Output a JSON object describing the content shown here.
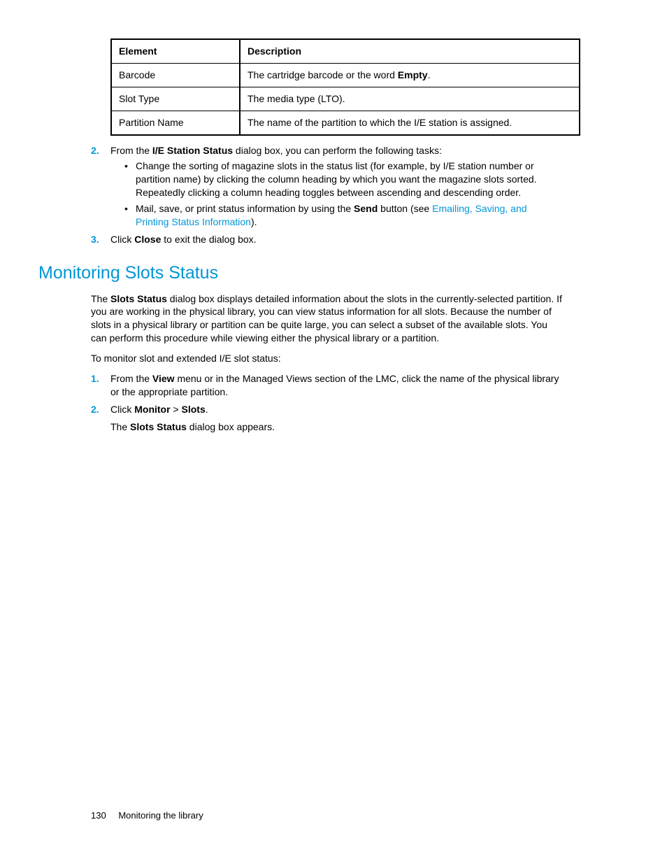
{
  "table": {
    "headers": {
      "element": "Element",
      "description": "Description"
    },
    "rows": [
      {
        "element": "Barcode",
        "desc_pre": "The cartridge barcode or the word ",
        "desc_bold": "Empty",
        "desc_post": "."
      },
      {
        "element": "Slot Type",
        "desc_pre": "The media type (LTO).",
        "desc_bold": "",
        "desc_post": ""
      },
      {
        "element": "Partition Name",
        "desc_pre": "The name of the partition to which the I/E station is assigned.",
        "desc_bold": "",
        "desc_post": ""
      }
    ]
  },
  "step2": {
    "num": "2.",
    "pre": "From the ",
    "bold": "I/E Station Status",
    "post": " dialog box, you can perform the following tasks:",
    "bullet1": "Change the sorting of magazine slots in the status list (for example, by I/E station number or partition name) by clicking the column heading by which you want the magazine slots sorted. Repeatedly clicking a column heading toggles between ascending and descending order.",
    "bullet2_pre": "Mail, save, or print status information by using the ",
    "bullet2_bold": "Send",
    "bullet2_mid": " button (see ",
    "bullet2_link": "Emailing, Saving, and Printing Status Information",
    "bullet2_post": ")."
  },
  "step3": {
    "num": "3.",
    "pre": "Click ",
    "bold": "Close",
    "post": " to exit the dialog box."
  },
  "section": {
    "title": "Monitoring Slots Status",
    "para1_pre": "The ",
    "para1_bold": "Slots Status",
    "para1_post": " dialog box displays detailed information about the slots in the currently-selected partition. If you are working in the physical library, you can view status information for all slots. Because the number of slots in a physical library or partition can be quite large, you can select a subset of the available slots. You can perform this procedure while viewing either the physical library or a partition.",
    "para2": "To monitor slot and extended I/E slot status:",
    "s1": {
      "num": "1.",
      "pre": "From the ",
      "bold": "View",
      "post": " menu or in the Managed Views section of the LMC, click the name of the physical library or the appropriate partition."
    },
    "s2": {
      "num": "2.",
      "pre": "Click ",
      "bold1": "Monitor",
      "sep": " > ",
      "bold2": "Slots",
      "post": ".",
      "line2_pre": "The ",
      "line2_bold": "Slots Status",
      "line2_post": " dialog box appears."
    }
  },
  "footer": {
    "page": "130",
    "chapter": "Monitoring the library"
  }
}
